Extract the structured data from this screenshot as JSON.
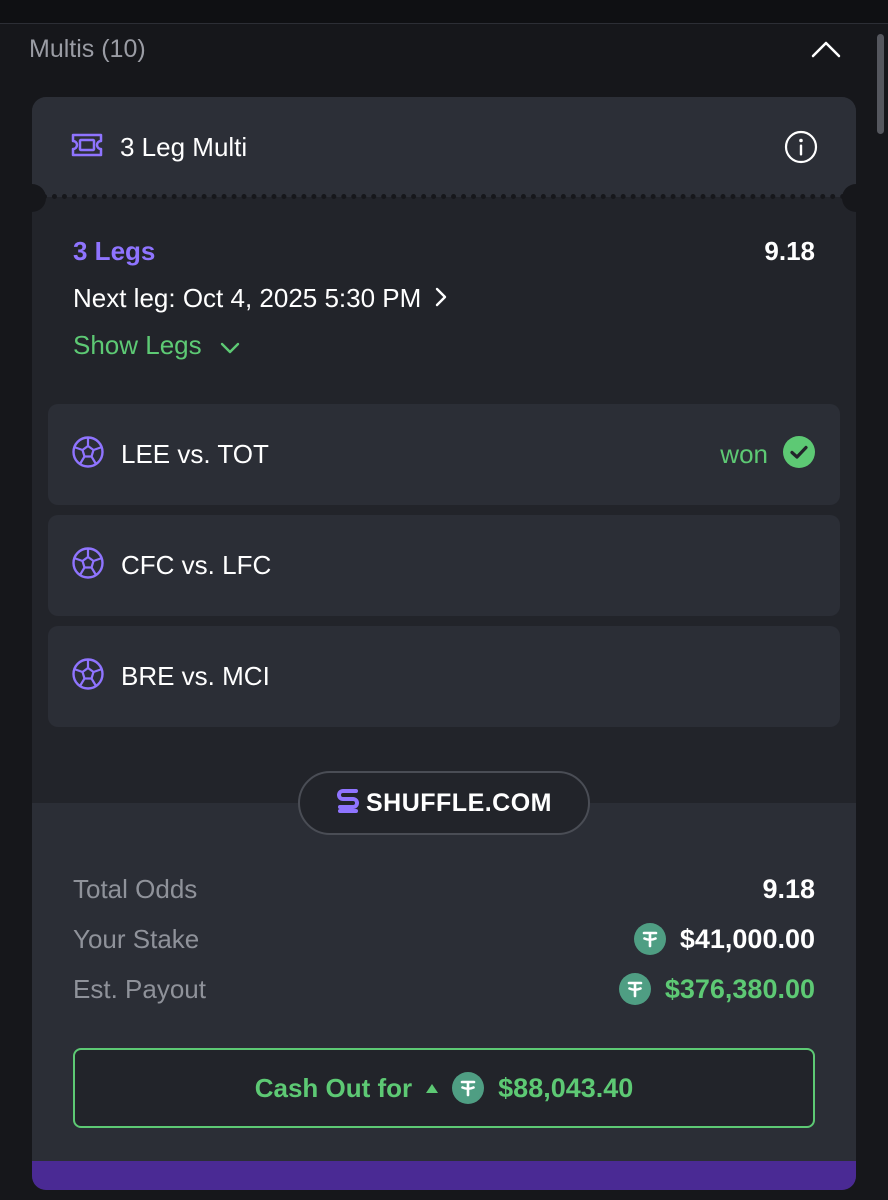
{
  "section": {
    "title": "Multis (10)"
  },
  "card": {
    "title": "3 Leg Multi",
    "legs_count_label": "3 Legs",
    "odds": "9.18",
    "next_leg": "Next leg: Oct 4, 2025 5:30 PM",
    "show_legs_label": "Show Legs"
  },
  "legs": [
    {
      "name": "LEE vs. TOT",
      "status": "won"
    },
    {
      "name": "CFC vs. LFC",
      "status": ""
    },
    {
      "name": "BRE vs. MCI",
      "status": ""
    }
  ],
  "brand": {
    "name": "SHUFFLE.COM"
  },
  "summary": {
    "total_odds_label": "Total Odds",
    "total_odds_value": "9.18",
    "stake_label": "Your Stake",
    "stake_value": "$41,000.00",
    "payout_label": "Est. Payout",
    "payout_value": "$376,380.00"
  },
  "cashout": {
    "label": "Cash Out for",
    "amount": "$88,043.40"
  },
  "icons": {
    "collapse": "chevron-up-icon",
    "ticket": "ticket-icon",
    "info": "info-icon",
    "next": "chevron-right-icon",
    "expand": "chevron-down-icon",
    "soccer": "soccer-ball-icon",
    "won": "check-circle-icon",
    "currency": "tether-coin-icon",
    "brand": "shuffle-logo-icon",
    "trend": "triangle-up-icon"
  },
  "colors": {
    "accent_purple": "#8f74ff",
    "win_green": "#5dc974",
    "coin_teal": "#4f9e83",
    "brand_bar": "#4a2a94"
  }
}
